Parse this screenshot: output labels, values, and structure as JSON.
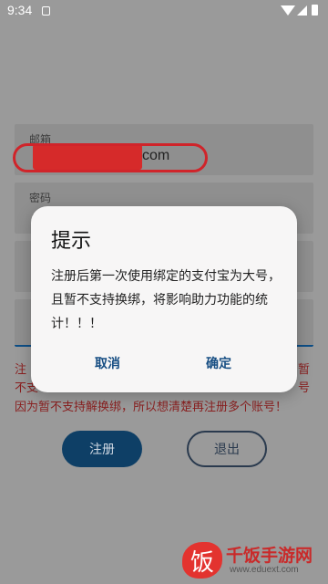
{
  "status_bar": {
    "time": "9:34"
  },
  "form": {
    "email_label": "邮箱",
    "email_value_visible": "com",
    "password_label": "密码",
    "password_value": "•"
  },
  "warning": {
    "left_line1": "注",
    "left_line2": "不支",
    "right_line1": "暂",
    "right_line2": "号",
    "line3": "因为暂不支持解换绑，所以想清楚再注册多个账号！"
  },
  "buttons": {
    "register": "注册",
    "exit": "退出"
  },
  "dialog": {
    "title": "提示",
    "message": "注册后第一次使用绑定的支付宝为大号，且暂不支持换绑，将影响助力功能的统计！！！",
    "cancel": "取消",
    "confirm": "确定"
  },
  "watermark": {
    "logo_char": "饭",
    "title": "千饭手游网",
    "url": "www.eduext.com"
  },
  "colors": {
    "accent": "#0e3f66",
    "warning_text": "#8a1f1f",
    "highlight_ring": "#d0242a"
  }
}
